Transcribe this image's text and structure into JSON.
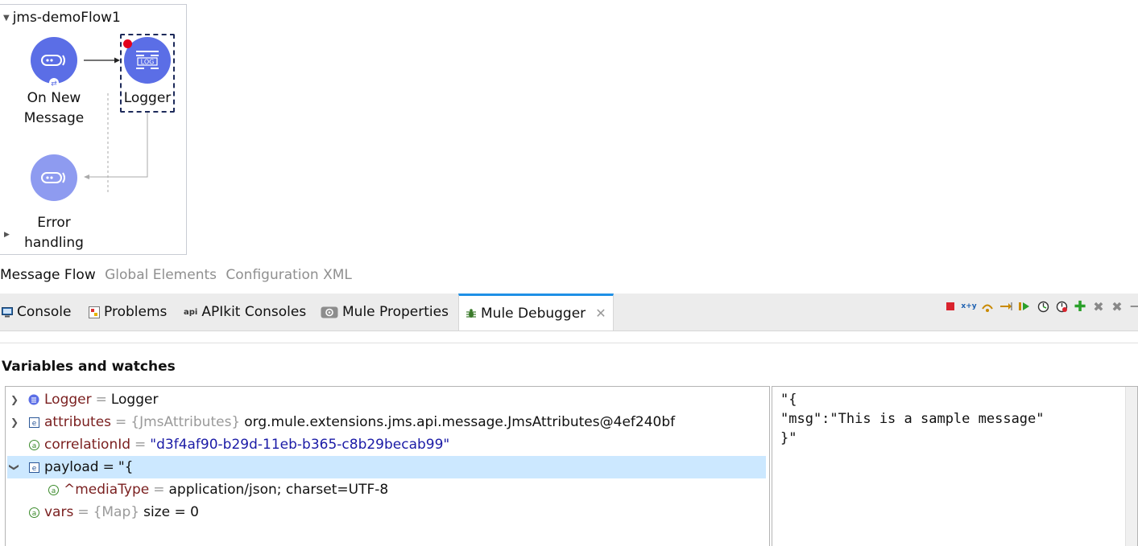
{
  "flow": {
    "name": "jms-demoFlow1",
    "source_label_line1": "On New",
    "source_label_line2": "Message",
    "processor_label": "Logger",
    "processor_icon_text": "LOG",
    "error_label_line1": "Error",
    "error_label_line2": "handling"
  },
  "editor_tabs": [
    {
      "label": "Message Flow",
      "active": true
    },
    {
      "label": "Global Elements",
      "active": false
    },
    {
      "label": "Configuration XML",
      "active": false
    }
  ],
  "view_tabs": [
    {
      "label": "Console",
      "icon": "console-icon"
    },
    {
      "label": "Problems",
      "icon": "problems-icon"
    },
    {
      "label": "APIkit Consoles",
      "icon": "api-icon",
      "icon_text": "api"
    },
    {
      "label": "Mule Properties",
      "icon": "properties-icon"
    },
    {
      "label": "Mule Debugger",
      "icon": "debugger-icon",
      "active": true
    }
  ],
  "debugger": {
    "section_title": "Variables and watches",
    "rows": [
      {
        "name": "Logger",
        "eq": "=",
        "value": "Logger",
        "icon": "processor-icon"
      },
      {
        "name": "attributes",
        "eq": "=",
        "type": "{JmsAttributes}",
        "value": "org.mule.extensions.jms.api.message.JmsAttributes@4ef240bf",
        "icon": "object-icon"
      },
      {
        "name": "correlationId",
        "eq": "=",
        "value": "\"d3f4af90-b29d-11eb-b365-c8b29becab99\"",
        "icon": "attribute-icon"
      },
      {
        "name": "payload",
        "eq": "=",
        "value": "\"{",
        "icon": "object-icon"
      },
      {
        "name": "^mediaType",
        "eq": "=",
        "value": "application/json; charset=UTF-8",
        "icon": "attribute-icon"
      },
      {
        "name": "vars",
        "eq": "=",
        "type": "{Map}",
        "value": "size = 0",
        "icon": "attribute-icon"
      }
    ],
    "detail_text": "\"{\n\"msg\":\"This is a sample message\"\n}\""
  },
  "colors": {
    "node": "#5b6ee6",
    "node_light": "#8e9bf0",
    "active_tab_accent": "#1e90e6",
    "selection": "#cce8ff"
  }
}
